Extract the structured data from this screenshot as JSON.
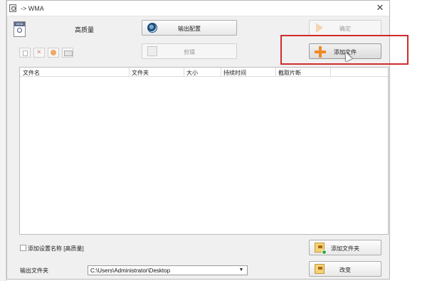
{
  "window": {
    "title": "-> WMA",
    "close_label": "✕"
  },
  "preset": {
    "icon_text": "WMA",
    "name": "高质量",
    "checkbox_label": "添加设置名称 [高质量]"
  },
  "buttons": {
    "output_config": "输出配置",
    "ok": "确定",
    "edit": "剪辑",
    "add_file": "添加文件",
    "add_folder": "添加文件夹",
    "change": "改变"
  },
  "table": {
    "columns": [
      "文件名",
      "文件夹",
      "大小",
      "持续时间",
      "截取片断"
    ]
  },
  "output": {
    "label": "输出文件夹",
    "path": "C:\\Users\\Administrator\\Desktop"
  },
  "colors": {
    "highlight": "#d02b2b",
    "accent_orange": "#f08a24"
  }
}
